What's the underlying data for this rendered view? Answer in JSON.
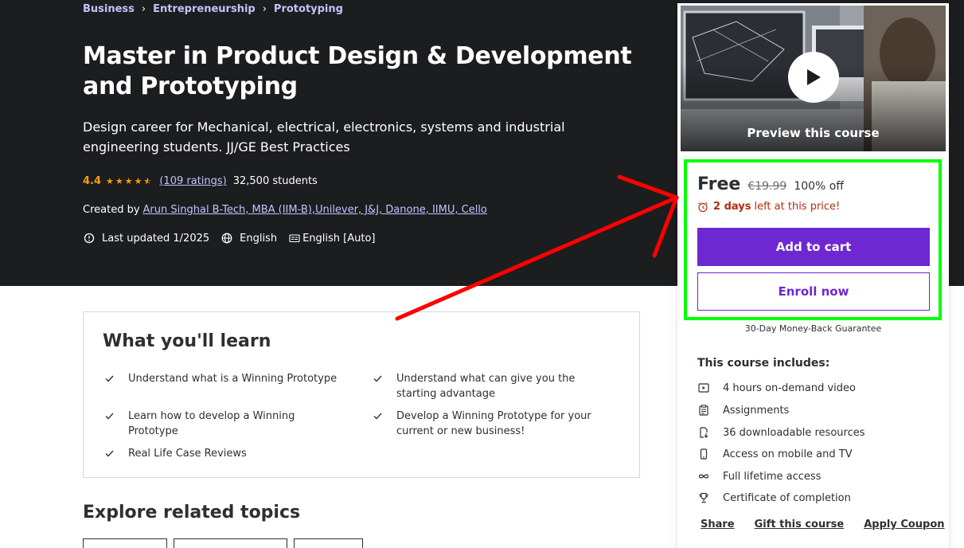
{
  "breadcrumb": [
    "Business",
    "Entrepreneurship",
    "Prototyping"
  ],
  "course": {
    "title": "Master in Product Design & Development and Prototyping",
    "subtitle": "Design career for Mechanical, electrical, electronics, systems and industrial engineering students. JJ/GE Best Practices",
    "rating": "4.4",
    "stars_value": 4.4,
    "ratings_count": "(109 ratings)",
    "students": "32,500 students",
    "created_by_label": "Created by",
    "author": "Arun Singhal B-Tech, MBA (IIM-B),Unilever, J&J, Danone, IIMU, Cello",
    "last_updated": "Last updated 1/2025",
    "language": "English",
    "captions": "English [Auto]"
  },
  "learn": {
    "title": "What you'll learn",
    "items": [
      "Understand what is a Winning Prototype",
      "Understand what can give you the starting advantage",
      "Learn how to develop a Winning Prototype",
      "Develop a Winning Prototype for your current or new business!",
      "Real Life Case Reviews"
    ]
  },
  "explore": {
    "title": "Explore related topics"
  },
  "sidebar": {
    "preview_label": "Preview this course",
    "price": "Free",
    "original_price": "€19.99",
    "discount": "100% off",
    "timer_days": "2 days",
    "timer_rest": "left at this price!",
    "add_to_cart": "Add to cart",
    "enroll_now": "Enroll now",
    "guarantee": "30-Day Money-Back Guarantee",
    "includes_title": "This course includes:",
    "includes": [
      {
        "icon": "video-icon",
        "label": "4 hours on-demand video"
      },
      {
        "icon": "assignment-icon",
        "label": "Assignments"
      },
      {
        "icon": "download-icon",
        "label": "36 downloadable resources"
      },
      {
        "icon": "mobile-icon",
        "label": "Access on mobile and TV"
      },
      {
        "icon": "infinity-icon",
        "label": "Full lifetime access"
      },
      {
        "icon": "trophy-icon",
        "label": "Certificate of completion"
      }
    ],
    "share": "Share",
    "gift": "Gift this course",
    "coupon": "Apply Coupon"
  },
  "colors": {
    "hero_bg": "#1c1d1f",
    "link_purple": "#c0c4fc",
    "accent": "#6d28d2",
    "star": "#f69c08",
    "timer_red": "#b32d0f",
    "highlight": "#00ff00",
    "arrow": "#ff0000"
  }
}
